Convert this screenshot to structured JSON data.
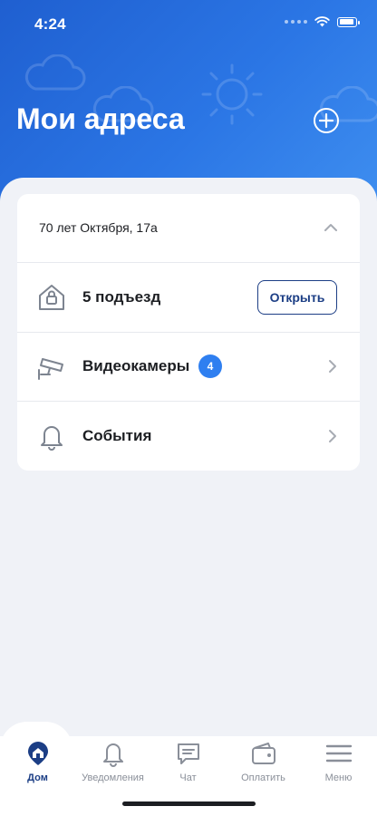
{
  "status_bar": {
    "time": "4:24"
  },
  "header": {
    "title": "Мои адреса"
  },
  "address": {
    "name": "70 лет Октября, 17а",
    "items": [
      {
        "label": "5 подъезд",
        "button_label": "Открыть"
      },
      {
        "label": "Видеокамеры",
        "badge": "4"
      },
      {
        "label": "События"
      }
    ]
  },
  "tab_bar": {
    "tabs": [
      {
        "label": "Дом",
        "icon": "home-icon",
        "active": true
      },
      {
        "label": "Уведомления",
        "icon": "bell-icon",
        "active": false
      },
      {
        "label": "Чат",
        "icon": "chat-icon",
        "active": false
      },
      {
        "label": "Оплатить",
        "icon": "wallet-icon",
        "active": false
      },
      {
        "label": "Меню",
        "icon": "menu-icon",
        "active": false
      }
    ]
  },
  "colors": {
    "header_gradient_start": "#1f5fd0",
    "header_gradient_end": "#3f8ff0",
    "accent_dark": "#1c3e85",
    "badge": "#2f7ff0",
    "background": "#f0f2f7"
  }
}
